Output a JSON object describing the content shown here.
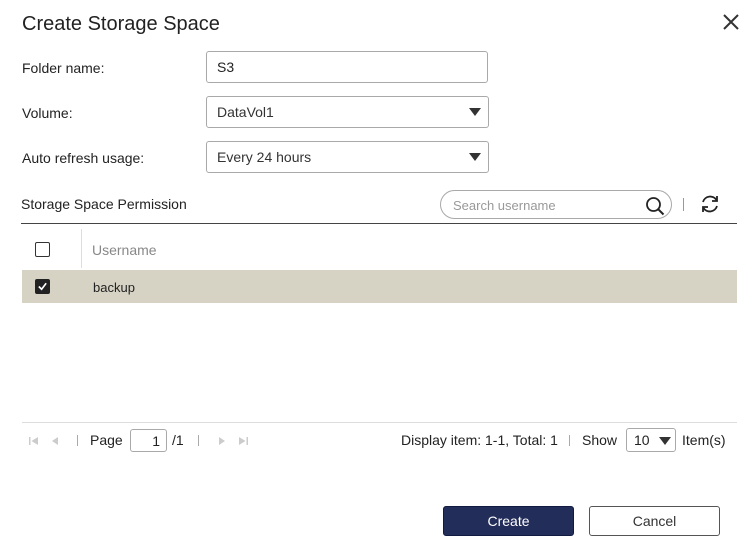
{
  "dialog": {
    "title": "Create Storage Space"
  },
  "form": {
    "folder_name_label": "Folder name:",
    "folder_name_value": "S3",
    "volume_label": "Volume:",
    "volume_value": "DataVol1",
    "auto_refresh_label": "Auto refresh usage:",
    "auto_refresh_value": "Every 24 hours"
  },
  "permission": {
    "section_title": "Storage Space Permission",
    "search_placeholder": "Search username",
    "columns": {
      "username": "Username"
    },
    "rows": [
      {
        "username": "backup",
        "checked": true
      }
    ]
  },
  "pager": {
    "page_label": "Page",
    "page_value": "1",
    "page_total": "/1",
    "display_info": "Display item: 1-1, Total: 1",
    "show_label": "Show",
    "show_value": "10",
    "items_label": "Item(s)"
  },
  "buttons": {
    "create": "Create",
    "cancel": "Cancel"
  },
  "colors": {
    "primary_button": "#232d5a",
    "selected_row": "#d6d2c4"
  },
  "icons": [
    "close-icon",
    "search-icon",
    "refresh-icon",
    "first-page-icon",
    "prev-page-icon",
    "next-page-icon",
    "last-page-icon",
    "chevron-down-icon",
    "checkmark-icon"
  ]
}
